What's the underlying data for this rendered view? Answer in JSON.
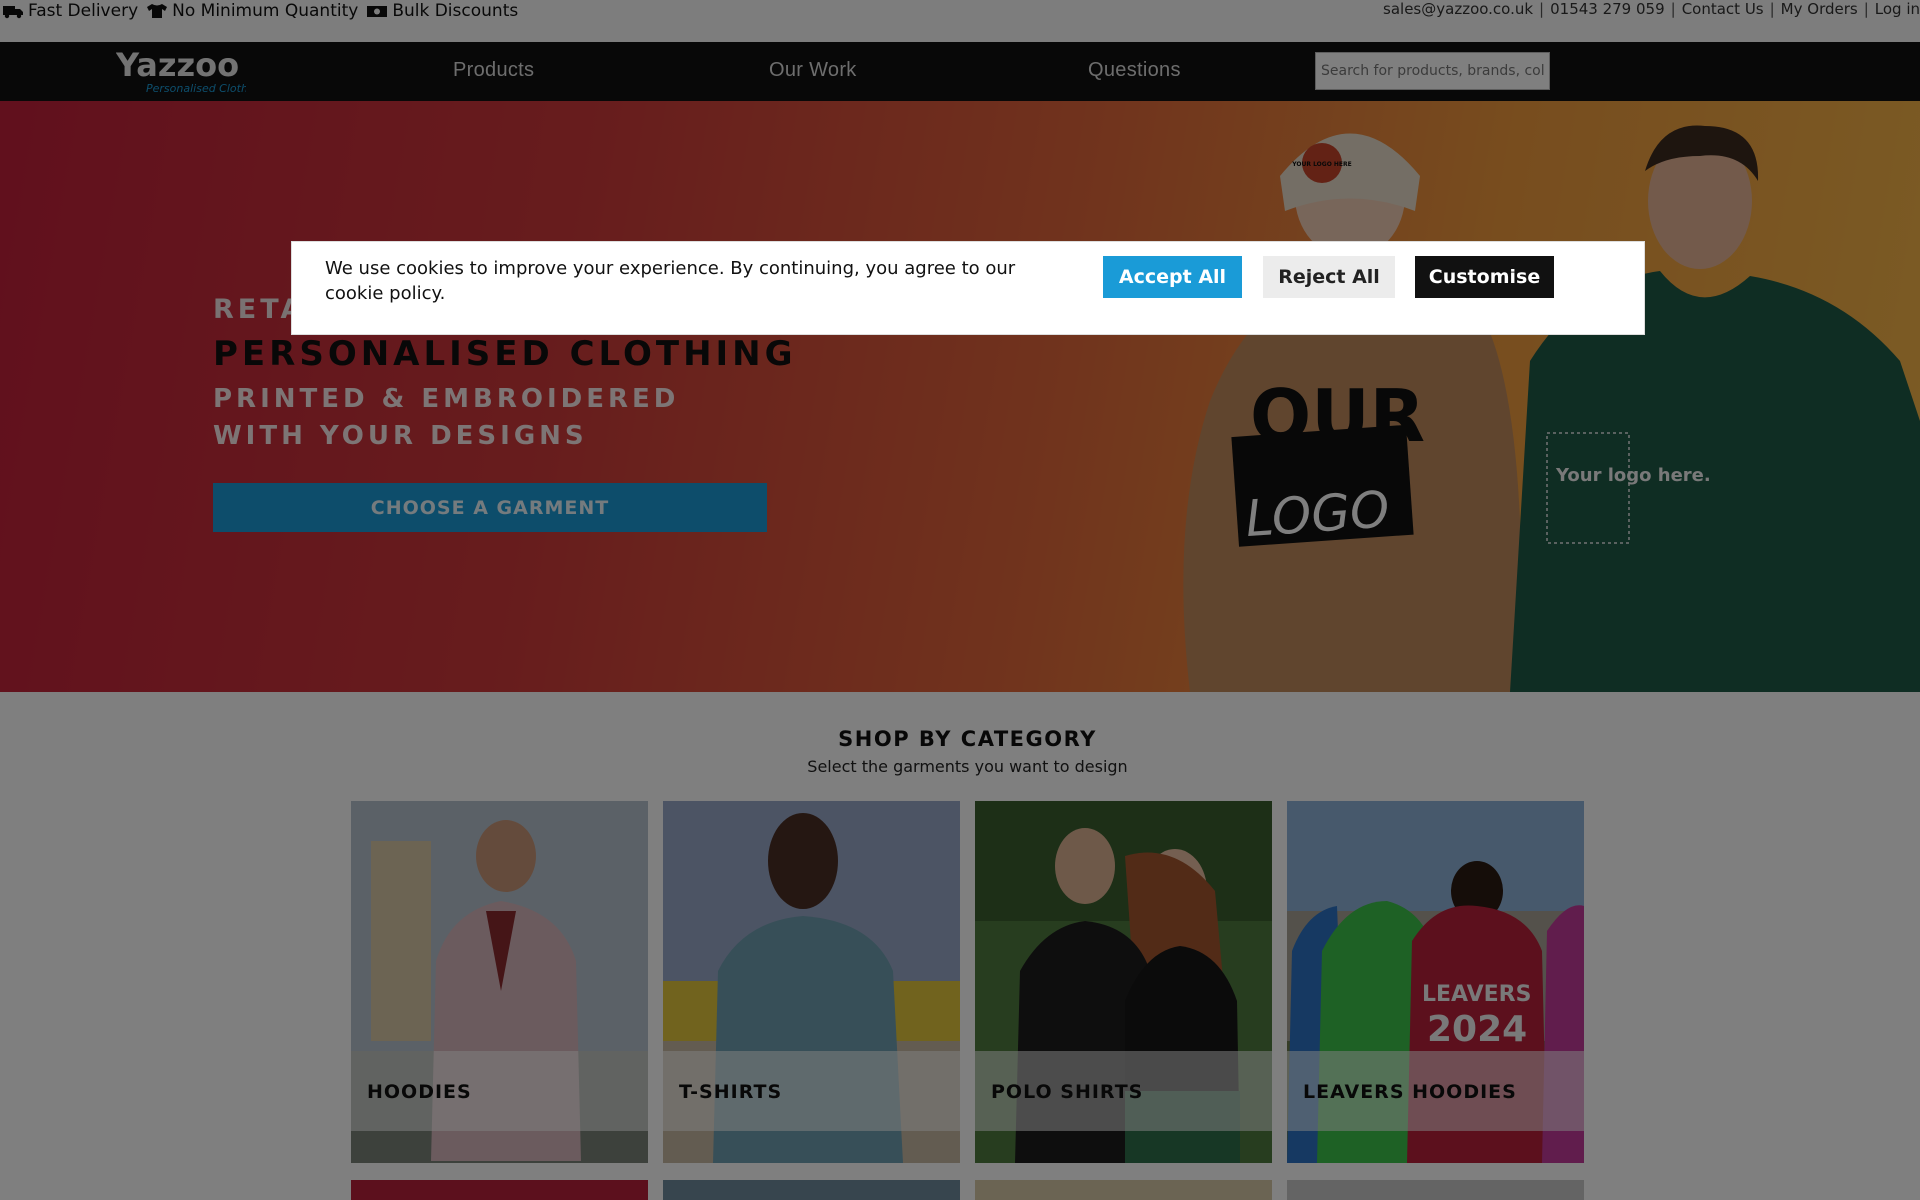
{
  "topbar": {
    "usps": [
      {
        "icon": "truck-icon",
        "label": "Fast Delivery"
      },
      {
        "icon": "tshirt-icon",
        "label": "No Minimum Quantity"
      },
      {
        "icon": "money-icon",
        "label": "Bulk Discounts"
      }
    ],
    "links": {
      "email": "sales@yazzoo.co.uk",
      "phone": "01543 279 059",
      "contact": "Contact Us",
      "orders": "My Orders",
      "login": "Log in"
    }
  },
  "nav": {
    "logo_main": "Yazzoo",
    "logo_tagline": "Personalised Clothing",
    "items": [
      "Products",
      "Our Work",
      "Questions"
    ],
    "search_placeholder": "Search for products, brands, colours..."
  },
  "hero": {
    "line1": "RETA",
    "line2": "PERSONALISED CLOTHING",
    "line3": "PRINTED & EMBROIDERED",
    "line4": "WITH YOUR DESIGNS",
    "cta": "CHOOSE A GARMENT",
    "beanie_badge": "YOUR LOGO HERE",
    "sweater_print_1": "OUR",
    "sweater_print_2": "LOGO",
    "hoodie_print": "Your logo here."
  },
  "category": {
    "title": "SHOP BY CATEGORY",
    "subtitle": "Select the garments you want to design",
    "cards": [
      {
        "label": "HOODIES",
        "color": "#d8b7bd"
      },
      {
        "label": "T-SHIRTS",
        "color": "#6f9fb0"
      },
      {
        "label": "POLO SHIRTS",
        "color": "#1c1c1c"
      },
      {
        "label": "LEAVERS HOODIES",
        "color": "#b8203a"
      }
    ],
    "leavers_print_1": "LEAVERS",
    "leavers_print_2": "2024"
  },
  "cookie": {
    "message": "We use cookies to improve your experience. By continuing, you agree to our cookie policy.",
    "accept": "Accept All",
    "reject": "Reject All",
    "customise": "Customise"
  },
  "colors": {
    "accent": "#1a9bd7",
    "nav_bg": "#111111",
    "hero_start": "#c2203a",
    "hero_end": "#f7b94a"
  }
}
